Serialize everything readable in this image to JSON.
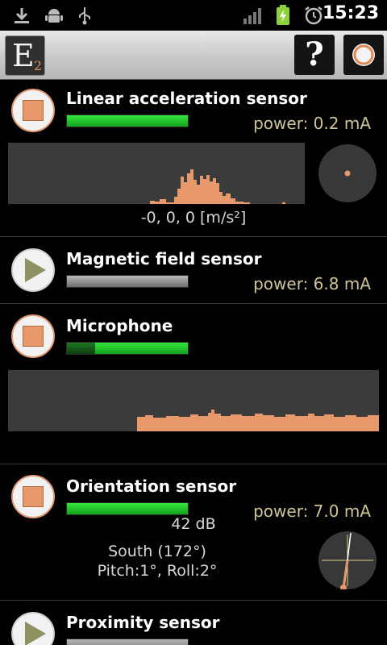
{
  "status_bar": {
    "time": "15:23",
    "icons": [
      "download-icon",
      "android-debug-icon",
      "usb-icon",
      "signal-icon",
      "battery-charging-icon",
      "alarm-icon"
    ]
  },
  "action_bar": {
    "logo_letter": "E",
    "logo_subscript": "2",
    "help_label": "?",
    "icons": [
      "help-icon",
      "power-icon"
    ]
  },
  "sensors": [
    {
      "name": "Linear acceleration sensor",
      "state": "running",
      "power": "power: 0.2 mA",
      "reading": "-0, 0, 0 [m/s²]",
      "power_level": 1.0
    },
    {
      "name": "Magnetic field sensor",
      "state": "stopped",
      "power": "power: 6.8 mA",
      "power_level": 1.0
    },
    {
      "name": "Microphone",
      "state": "running",
      "reading": "42 dB",
      "power_level": 0.77
    },
    {
      "name": "Orientation sensor",
      "state": "running",
      "power": "power: 7.0 mA",
      "reading_line1": "South (172°)",
      "reading_line2": "Pitch:1°, Roll:2°",
      "power_level": 1.0
    },
    {
      "name": "Proximity sensor",
      "state": "stopped"
    }
  ],
  "colors": {
    "accent": "#e8996b",
    "power_text": "#cdc59a",
    "bar_green": "#22c42b",
    "graph_bg": "#3b3b3b"
  }
}
